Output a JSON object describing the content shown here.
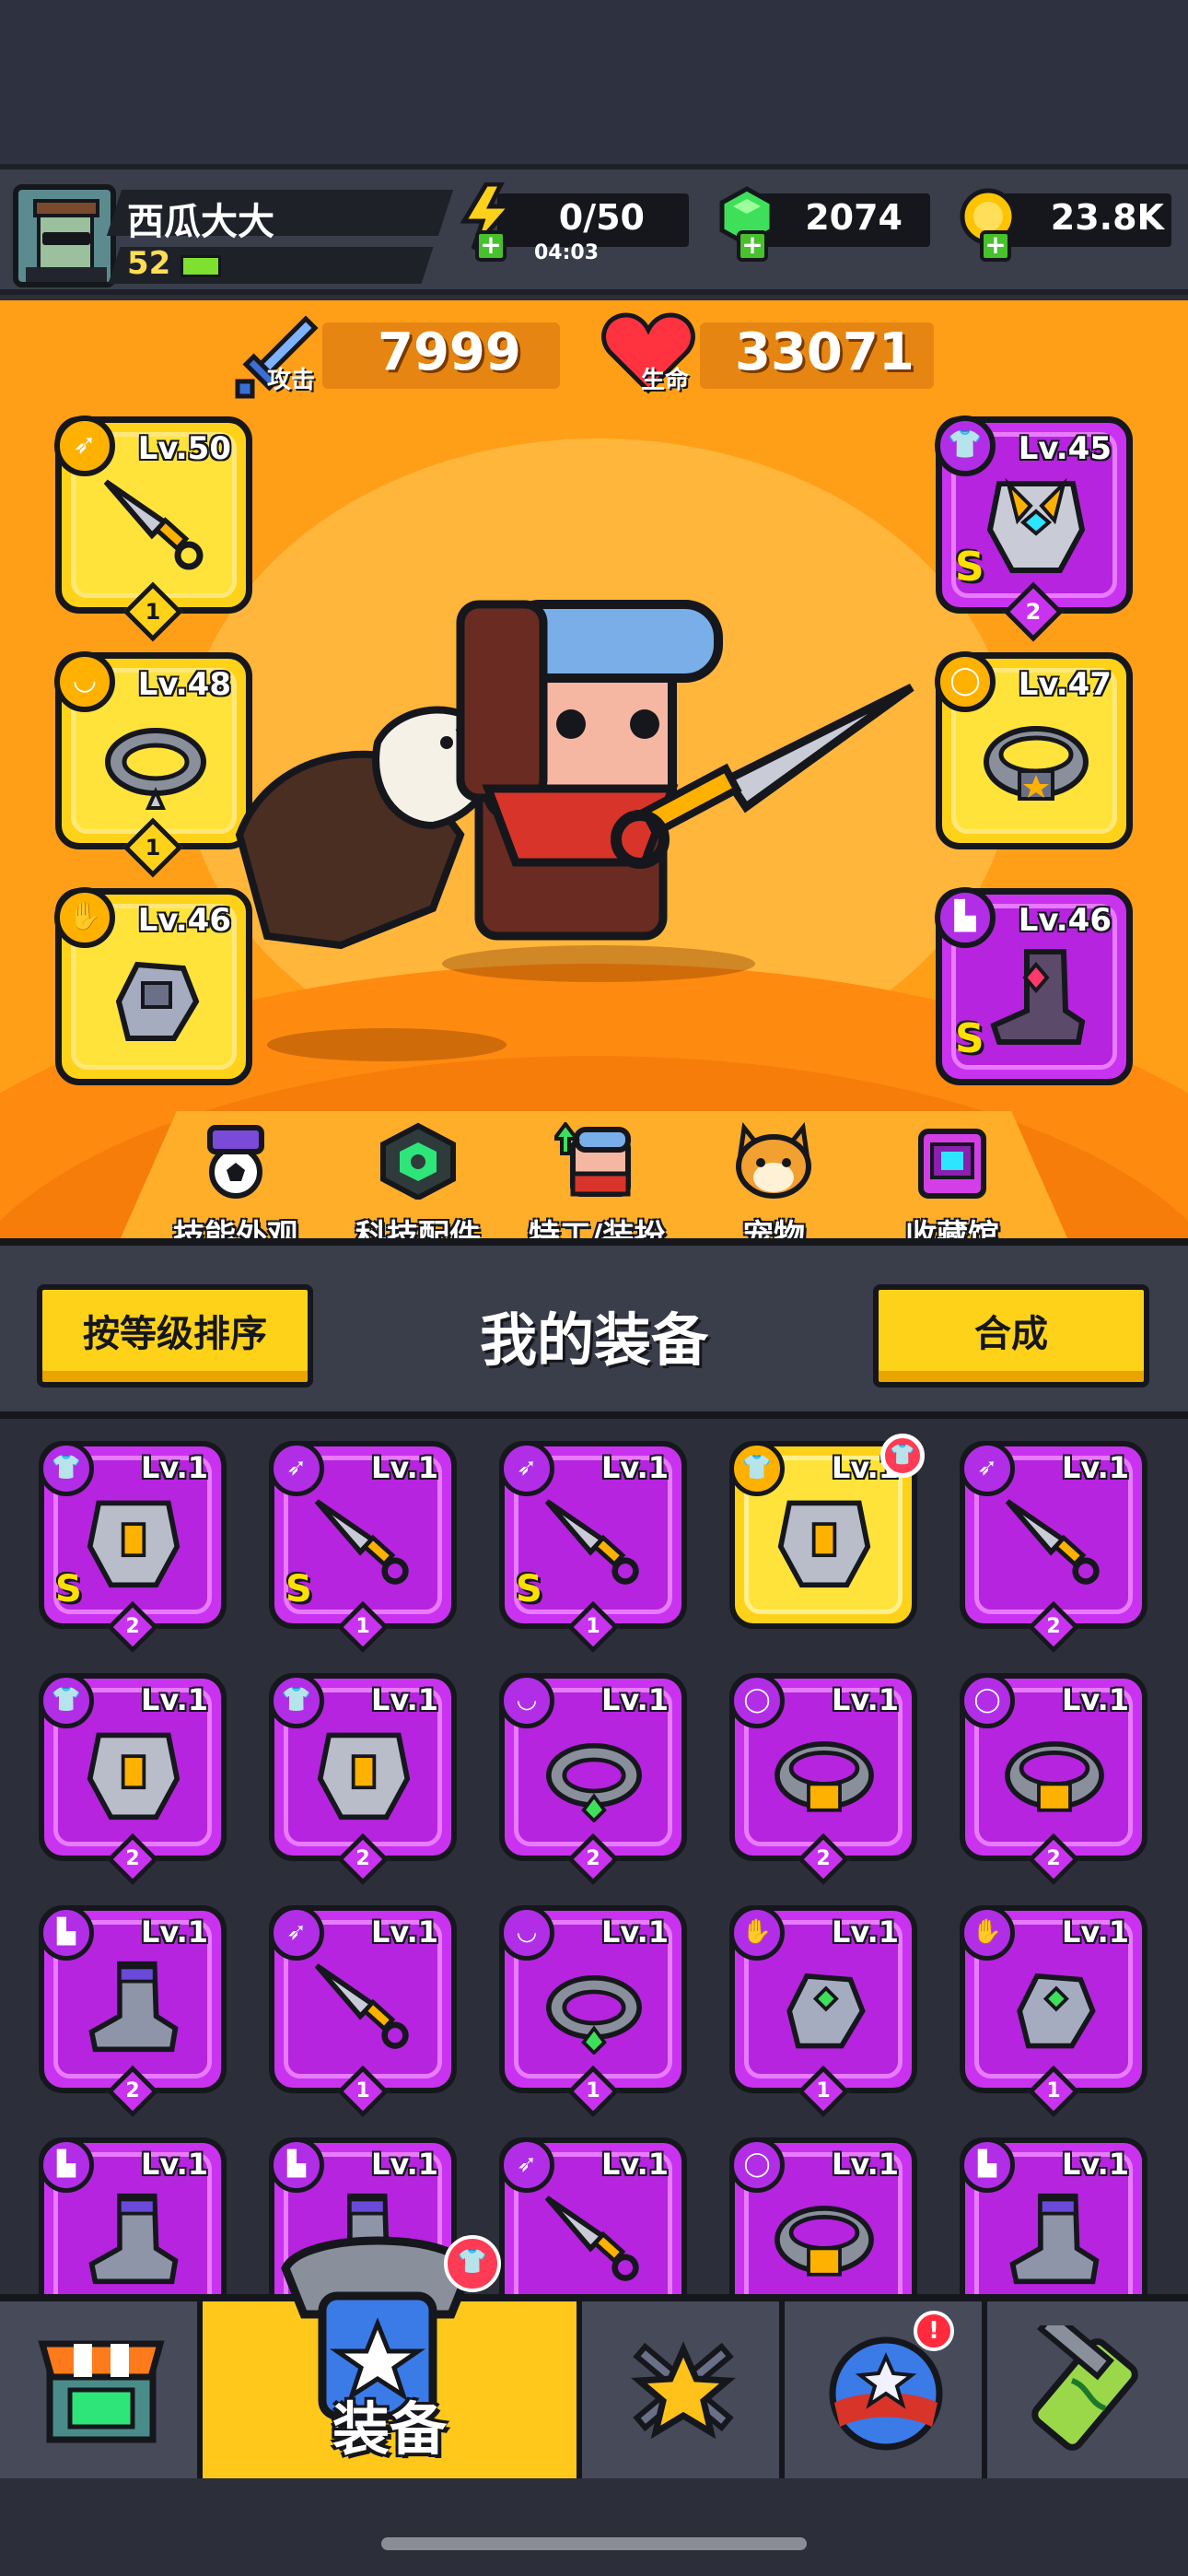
{
  "player": {
    "name": "西瓜大大",
    "level": "52",
    "xp_fraction": 0.15
  },
  "resources": {
    "energy": {
      "value": "0/50",
      "timer": "04:03"
    },
    "gems": {
      "value": "2074"
    },
    "coins": {
      "value": "23.8K"
    }
  },
  "stats": {
    "attack": {
      "label": "攻击",
      "value": "7999"
    },
    "hp": {
      "label": "生命",
      "value": "33071"
    }
  },
  "equipped": [
    {
      "slot": "weapon",
      "level": "Lv.50",
      "rank": "1",
      "s": false,
      "color": "gold"
    },
    {
      "slot": "necklace",
      "level": "Lv.48",
      "rank": "1",
      "s": false,
      "color": "gold"
    },
    {
      "slot": "gloves",
      "level": "Lv.46",
      "rank": "",
      "s": false,
      "color": "gold"
    },
    {
      "slot": "armor",
      "level": "Lv.45",
      "rank": "2",
      "s": true,
      "color": "purple"
    },
    {
      "slot": "belt",
      "level": "Lv.47",
      "rank": "",
      "s": false,
      "color": "gold"
    },
    {
      "slot": "boots",
      "level": "Lv.46",
      "rank": "",
      "s": true,
      "color": "purple"
    }
  ],
  "hero_menu": [
    {
      "label": "技能外观",
      "icon": "skill-skin-icon"
    },
    {
      "label": "科技配件",
      "icon": "tech-parts-icon"
    },
    {
      "label": "特工/装扮",
      "icon": "agent-costume-icon"
    },
    {
      "label": "宠物",
      "icon": "pet-icon"
    },
    {
      "label": "收藏馆",
      "icon": "collection-icon"
    }
  ],
  "equipment_section": {
    "title": "我的装备",
    "sort_label": "按等级排序",
    "merge_label": "合成"
  },
  "inventory": [
    {
      "type": "armor",
      "level": "Lv.1",
      "rank": "2",
      "s": true,
      "color": "purple"
    },
    {
      "type": "weapon",
      "level": "Lv.1",
      "rank": "1",
      "s": true,
      "color": "purple"
    },
    {
      "type": "weapon",
      "level": "Lv.1",
      "rank": "1",
      "s": true,
      "color": "purple"
    },
    {
      "type": "armor",
      "level": "Lv.1",
      "rank": "",
      "s": false,
      "color": "gold",
      "new": true
    },
    {
      "type": "weapon",
      "level": "Lv.1",
      "rank": "2",
      "s": false,
      "color": "purple"
    },
    {
      "type": "armor",
      "level": "Lv.1",
      "rank": "2",
      "s": false,
      "color": "purple"
    },
    {
      "type": "armor",
      "level": "Lv.1",
      "rank": "2",
      "s": false,
      "color": "purple"
    },
    {
      "type": "necklace",
      "level": "Lv.1",
      "rank": "2",
      "s": false,
      "color": "purple"
    },
    {
      "type": "belt",
      "level": "Lv.1",
      "rank": "2",
      "s": false,
      "color": "purple"
    },
    {
      "type": "belt",
      "level": "Lv.1",
      "rank": "2",
      "s": false,
      "color": "purple"
    },
    {
      "type": "boots",
      "level": "Lv.1",
      "rank": "2",
      "s": false,
      "color": "purple"
    },
    {
      "type": "weapon",
      "level": "Lv.1",
      "rank": "1",
      "s": false,
      "color": "purple"
    },
    {
      "type": "necklace",
      "level": "Lv.1",
      "rank": "1",
      "s": false,
      "color": "purple"
    },
    {
      "type": "gloves",
      "level": "Lv.1",
      "rank": "1",
      "s": false,
      "color": "purple"
    },
    {
      "type": "gloves",
      "level": "Lv.1",
      "rank": "1",
      "s": false,
      "color": "purple"
    },
    {
      "type": "boots",
      "level": "Lv.1",
      "rank": "",
      "s": false,
      "color": "purple"
    },
    {
      "type": "boots",
      "level": "Lv.1",
      "rank": "",
      "s": false,
      "color": "purple"
    },
    {
      "type": "weapon",
      "level": "Lv.1",
      "rank": "",
      "s": false,
      "color": "purple"
    },
    {
      "type": "belt",
      "level": "Lv.1",
      "rank": "",
      "s": false,
      "color": "purple"
    },
    {
      "type": "boots",
      "level": "Lv.1",
      "rank": "",
      "s": false,
      "color": "purple"
    }
  ],
  "nav": [
    {
      "id": "shop",
      "label": "",
      "icon": "shop-icon",
      "active": false
    },
    {
      "id": "equipment",
      "label": "装备",
      "icon": "equipment-icon",
      "active": true
    },
    {
      "id": "battle",
      "label": "",
      "icon": "battle-icon",
      "active": false
    },
    {
      "id": "events",
      "label": "",
      "icon": "stars-orb-icon",
      "active": false,
      "alert": "!"
    },
    {
      "id": "lab",
      "label": "",
      "icon": "dna-tube-icon",
      "active": false
    }
  ],
  "colors": {
    "accent": "#ffd21a",
    "hero_bg": "#ff9f18",
    "epic": "#c933ef",
    "dark": "#15171c"
  }
}
